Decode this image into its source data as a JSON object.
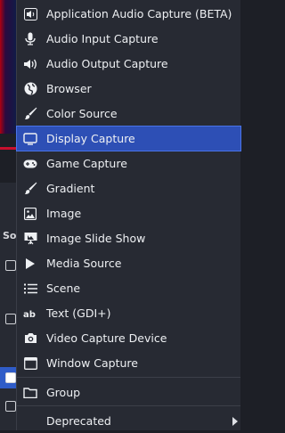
{
  "menu": {
    "items": [
      {
        "label": "Application Audio Capture (BETA)",
        "icon": "speaker-icon"
      },
      {
        "label": "Audio Input Capture",
        "icon": "microphone-icon"
      },
      {
        "label": "Audio Output Capture",
        "icon": "speaker-icon"
      },
      {
        "label": "Browser",
        "icon": "globe-icon"
      },
      {
        "label": "Color Source",
        "icon": "brush-icon"
      },
      {
        "label": "Display Capture",
        "icon": "monitor-icon"
      },
      {
        "label": "Game Capture",
        "icon": "gamepad-icon"
      },
      {
        "label": "Gradient",
        "icon": "brush-icon"
      },
      {
        "label": "Image",
        "icon": "image-icon"
      },
      {
        "label": "Image Slide Show",
        "icon": "slideshow-icon"
      },
      {
        "label": "Media Source",
        "icon": "play-icon"
      },
      {
        "label": "Scene",
        "icon": "list-icon"
      },
      {
        "label": "Text (GDI+)",
        "icon": "text-icon"
      },
      {
        "label": "Video Capture Device",
        "icon": "camera-icon"
      },
      {
        "label": "Window Capture",
        "icon": "window-icon"
      }
    ],
    "group": {
      "label": "Group",
      "icon": "folder-icon"
    },
    "deprecated": {
      "label": "Deprecated",
      "icon": "submenu-arrow-icon"
    },
    "selected_label": "Display Capture"
  },
  "background": {
    "dock_label": "So"
  },
  "colors": {
    "menu_bg": "#272a33",
    "selected_bg": "#2d4fb5",
    "text": "#eef0f3"
  }
}
